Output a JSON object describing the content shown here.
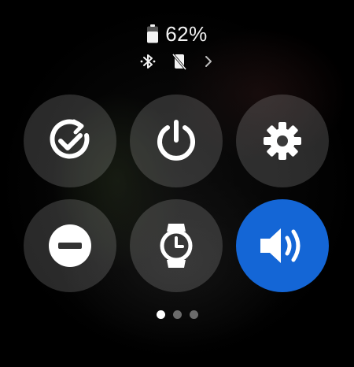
{
  "status": {
    "battery_percent": "62%",
    "battery_level": 0.62,
    "icons": [
      "battery-icon",
      "bluetooth-icon",
      "phone-disconnected-icon",
      "chevron-right-icon"
    ]
  },
  "tiles": [
    {
      "name": "sync-tile",
      "icon": "sync-check-icon",
      "active": false
    },
    {
      "name": "power-tile",
      "icon": "power-icon",
      "active": false
    },
    {
      "name": "settings-tile",
      "icon": "gear-icon",
      "active": false
    },
    {
      "name": "do-not-disturb-tile",
      "icon": "do-not-disturb-icon",
      "active": false
    },
    {
      "name": "watch-only-tile",
      "icon": "watch-icon",
      "active": false
    },
    {
      "name": "sound-tile",
      "icon": "volume-icon",
      "active": true
    }
  ],
  "page_indicator": {
    "current": 1,
    "total": 3
  },
  "colors": {
    "accent": "#1466d6",
    "tile_bg": "rgba(255,255,255,0.16)",
    "icon": "#ffffff",
    "dot_inactive": "#6b6b6b"
  }
}
